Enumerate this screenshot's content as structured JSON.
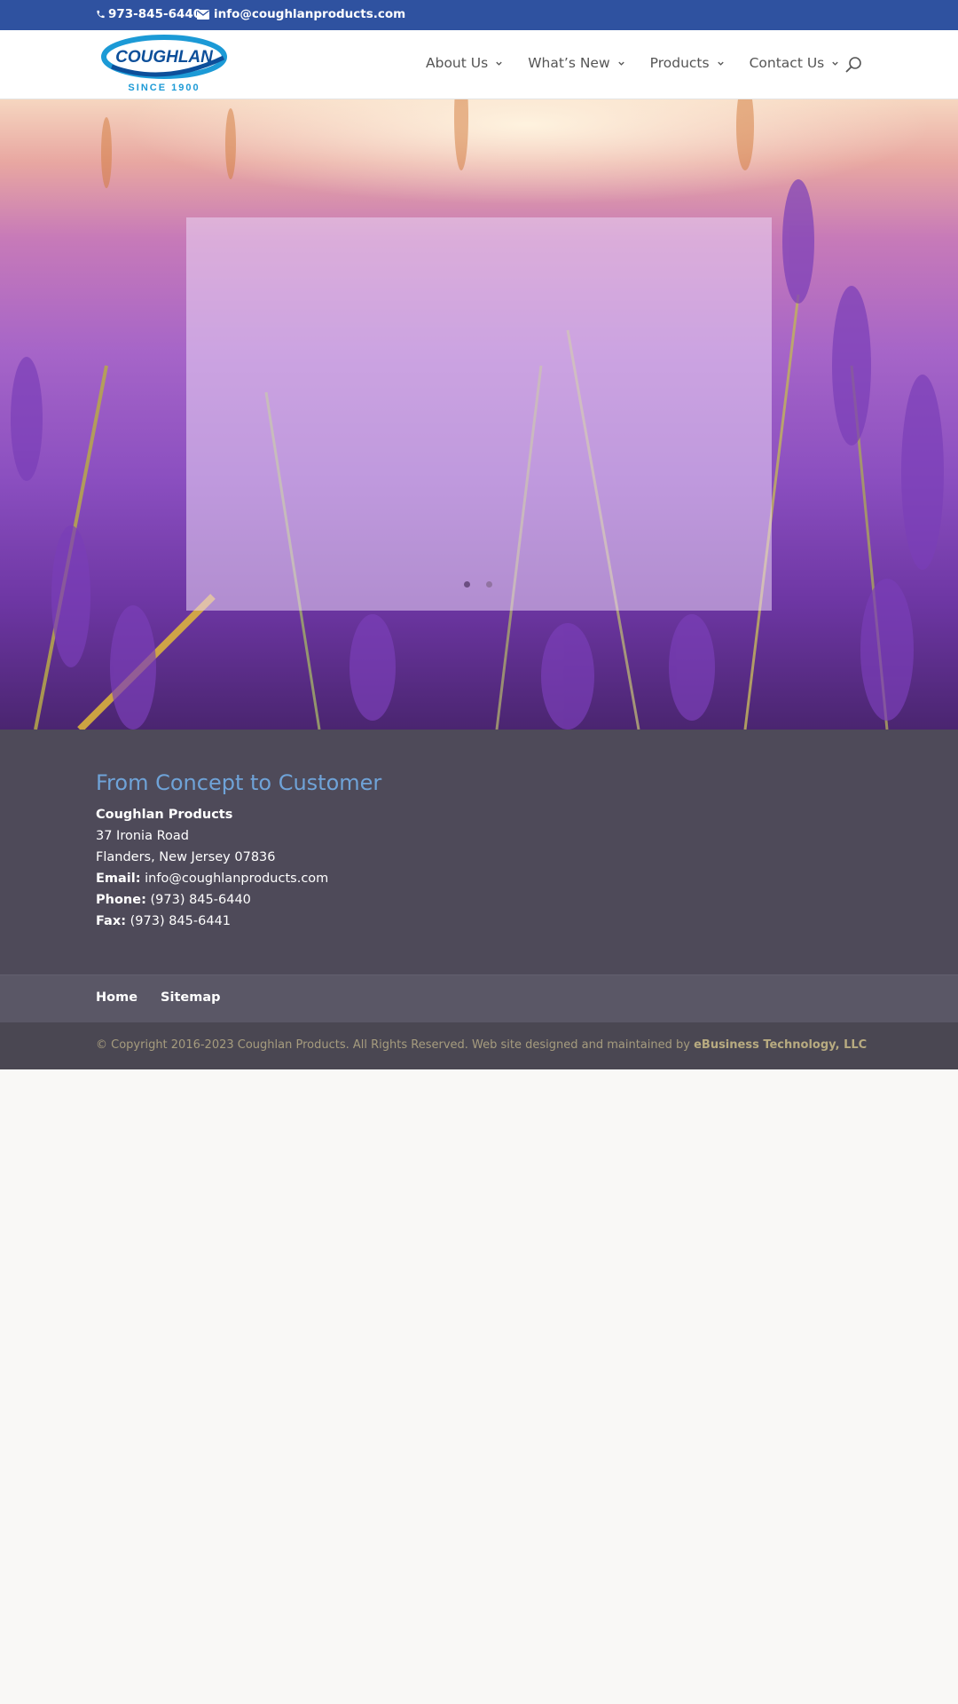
{
  "topbar": {
    "phone": "973-845-6440",
    "email": "info@coughlanproducts.com",
    "icons": {
      "phone": "phone-icon",
      "email": "envelope-icon"
    }
  },
  "header": {
    "logo": {
      "name": "COUGHLAN",
      "tagline": "SINCE 1900"
    },
    "nav": [
      {
        "label": "About Us"
      },
      {
        "label": "What’s New"
      },
      {
        "label": "Products"
      },
      {
        "label": "Contact Us"
      }
    ],
    "search_icon": "search-icon"
  },
  "hero": {
    "slider_dots": 2,
    "active_dot": 1
  },
  "footer": {
    "heading": "From Concept to Customer",
    "company": "Coughlan Products",
    "address_line1": "37 Ironia Road",
    "address_line2": "Flanders, New Jersey 07836",
    "email_label": "Email:",
    "email_value": "info@coughlanproducts.com",
    "phone_label": "Phone:",
    "phone_value": "(973) 845-6440",
    "fax_label": "Fax:",
    "fax_value": "(973) 845-6441",
    "links": [
      {
        "label": "Home"
      },
      {
        "label": "Sitemap"
      }
    ],
    "copyright": "© Copyright 2016-2023 Coughlan Products. All Rights Reserved. Web site designed and maintained by ",
    "credit_link": "eBusiness Technology, LLC"
  },
  "colors": {
    "topbar_bg": "#2f52a0",
    "footer_bg": "#4e4a59",
    "footer_nav_bg": "#5a5766",
    "footer_bottom_bg": "#4a4752",
    "heading_accent": "#6fa3d8",
    "copyright_text": "#a69c7e",
    "page_bg": "#f9f8f6"
  }
}
